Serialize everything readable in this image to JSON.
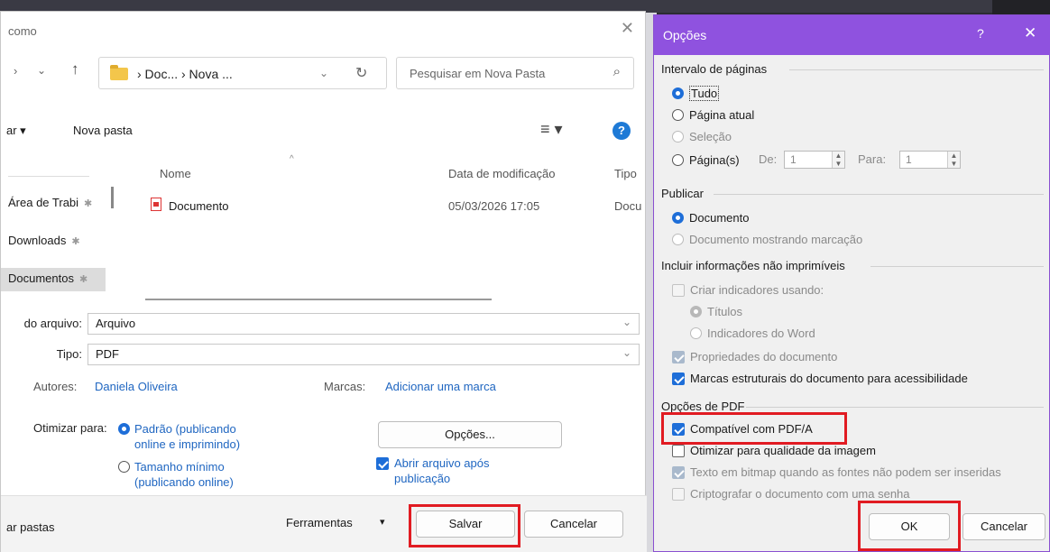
{
  "save_dialog": {
    "title": "como",
    "nav": {
      "breadcrumb": "› Doc... › Nova ...",
      "search_placeholder": "Pesquisar em Nova Pasta"
    },
    "toolbar": {
      "organize_label": "ar ▾",
      "new_folder_label": "Nova pasta"
    },
    "left_nav": [
      {
        "label": "Área de Trabi"
      },
      {
        "label": "Downloads"
      },
      {
        "label": "Documentos"
      }
    ],
    "columns": {
      "name": "Nome",
      "modified": "Data de modificação",
      "type": "Tipo"
    },
    "files": [
      {
        "name": "Documento",
        "modified": "05/03/2026 17:05",
        "type": "Docu"
      }
    ],
    "filename_label": "do arquivo:",
    "filename_value": "Arquivo",
    "type_label": "Tipo:",
    "type_value": "PDF",
    "authors_label": "Autores:",
    "authors_value": "Daniela Oliveira",
    "tags_label": "Marcas:",
    "tags_value": "Adicionar uma marca",
    "optimize_label": "Otimizar para:",
    "optimize_standard": "Padrão (publicando online e imprimindo)",
    "optimize_minimum": "Tamanho mínimo (publicando online)",
    "options_button": "Opções...",
    "open_after_label": "Abrir arquivo após publicação",
    "hide_folders": "ar pastas",
    "tools_label": "Ferramentas",
    "save_button": "Salvar",
    "cancel_button": "Cancelar"
  },
  "options_dialog": {
    "title": "Opções",
    "help": "?",
    "close": "✕",
    "page_range": {
      "heading": "Intervalo de páginas",
      "all": "Tudo",
      "current": "Página atual",
      "selection": "Seleção",
      "pages": "Página(s)",
      "from_label": "De:",
      "from_value": "1",
      "to_label": "Para:",
      "to_value": "1"
    },
    "publish": {
      "heading": "Publicar",
      "document": "Documento",
      "document_markup": "Documento mostrando marcação"
    },
    "nonprint": {
      "heading": "Incluir informações não imprimíveis",
      "bookmarks": "Criar indicadores usando:",
      "headings": "Títulos",
      "word_bookmarks": "Indicadores do Word",
      "doc_props": "Propriedades do documento",
      "tags": "Marcas estruturais do documento para acessibilidade"
    },
    "pdf_options": {
      "heading": "Opções de PDF",
      "pdfa": "Compatível com PDF/A",
      "image_quality": "Otimizar para qualidade da imagem",
      "bitmap_text": "Texto em bitmap quando as fontes não podem ser inseridas",
      "encrypt": "Criptografar o documento com uma senha"
    },
    "ok_button": "OK",
    "cancel_button": "Cancelar"
  },
  "colors": {
    "accent": "#1e6ed8",
    "title_bar": "#8f52df",
    "highlight": "#e11b22",
    "link": "#1f66c1"
  }
}
